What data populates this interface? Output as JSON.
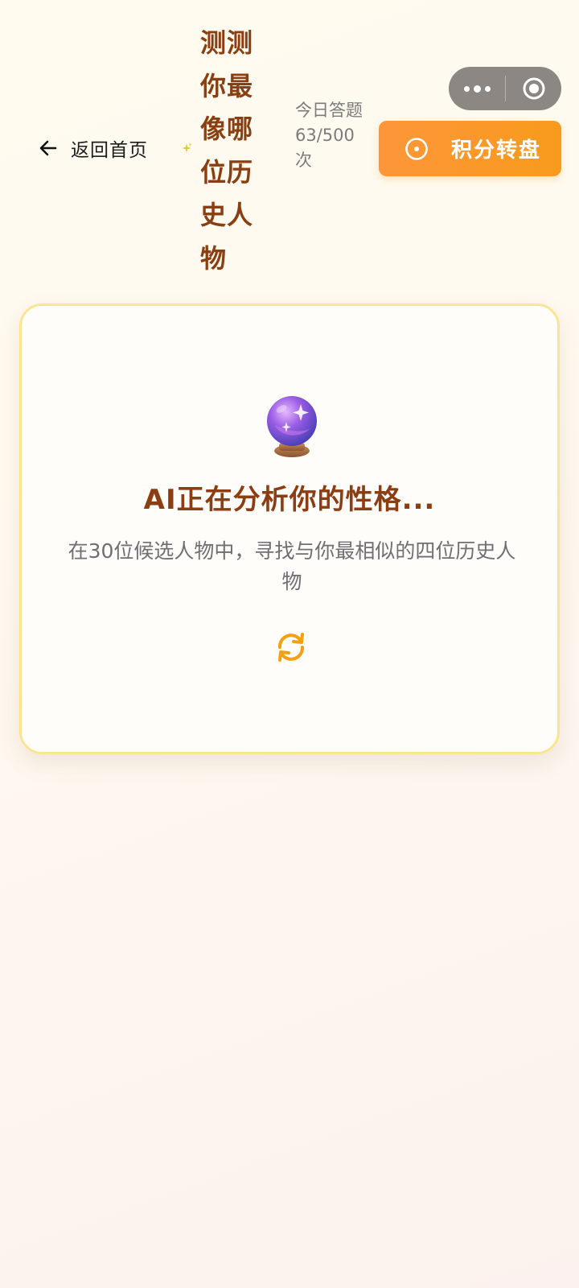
{
  "header": {
    "back_label": "返回首页",
    "title": "测测你最像哪位历史人物",
    "quota": "今日答题63/500次",
    "spin_button_label": "积分转盘"
  },
  "card": {
    "title": "AI正在分析你的性格...",
    "description": "在30位候选人物中，寻找与你最相似的四位历史人物"
  },
  "icons": {
    "back": "arrow-left-icon",
    "sparkle": "sparkle-icon",
    "spin": "target-icon",
    "orb": "crystal-ball-icon",
    "loading": "refresh-icon",
    "menu": "more-dots-icon",
    "close": "close-circle-icon"
  },
  "colors": {
    "title_brown": "#8a3f12",
    "orange_button": "#fd963a",
    "card_border": "#fbe592",
    "refresh_orange": "#f5a012"
  }
}
